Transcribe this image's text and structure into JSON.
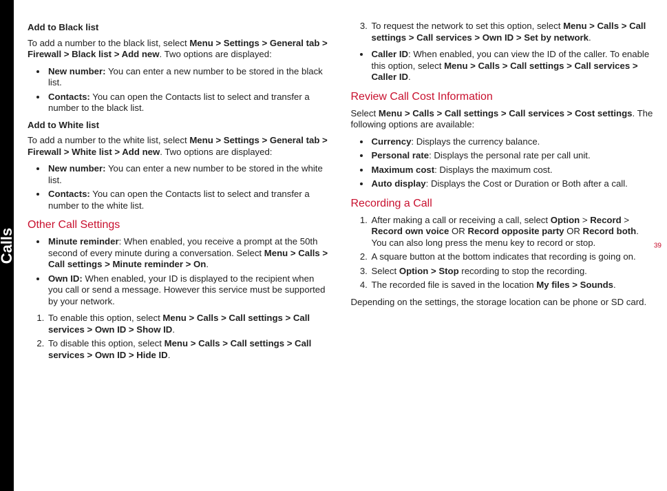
{
  "side_tab": "Calls",
  "page_number": "39",
  "left": {
    "h_black_list": "Add to Black list",
    "p_black_intro_a": "To add a number to the black list, select ",
    "p_black_intro_b": "Menu > Settings > General tab > Firewall > Black list > Add new",
    "p_black_intro_c": ". Two options are displayed:",
    "bl_newnum_b": "New number:",
    "bl_newnum_t": " You can enter a new number  to be stored in the black list.",
    "bl_contacts_b": "Contacts:",
    "bl_contacts_t": " You can open the Contacts list to select and transfer a number to the black list.",
    "h_white_list": "Add to White list",
    "p_white_intro_a": "To add a number to the white list, select ",
    "p_white_intro_b": "Menu > Settings > General tab > Firewall > White list > Add new",
    "p_white_intro_c": ". Two options are displayed:",
    "wl_newnum_b": "New number:",
    "wl_newnum_t": " You can enter a new number  to be stored in the white list.",
    "wl_contacts_b": "Contacts:",
    "wl_contacts_t": " You can open the Contacts list to select and transfer a number to the white list.",
    "h_other": "Other Call Settings",
    "other_min_b": "Minute reminder",
    "other_min_t1": ": When enabled, you receive a prompt at the 50th second of every minute during a conversation. Select ",
    "other_min_t2": "Menu > Calls > Call settings > Minute reminder > On",
    "other_min_t3": ".",
    "other_own_b": "Own ID:",
    "other_own_t": " When enabled,  your ID is displayed to the recipient when you call or send a message. However this service must be supported by your network.",
    "ol1_a": "To enable this option, select ",
    "ol1_b": "Menu > Calls > Call settings > Call services > Own ID > Show ID",
    "ol1_c": ".",
    "ol2_a": "To disable this option, select ",
    "ol2_b": "Menu > Calls > Call settings > Call services > Own ID > Hide ID",
    "ol2_c": "."
  },
  "right": {
    "ol3_a": "To request the network to set this option, select ",
    "ol3_b": "Menu > Calls > Call settings > Call services > Own ID > Set by network",
    "ol3_c": ".",
    "caller_b": "Caller ID",
    "caller_t1": ": When enabled, you can view the ID of the caller. To enable this option, select ",
    "caller_t2": "Menu > Calls > Call settings > Call services > Caller ID",
    "caller_t3": ".",
    "h_cost": "Review Call Cost Information",
    "cost_intro_a": "Select ",
    "cost_intro_b": "Menu > Calls > Call settings > Call services > Cost settings",
    "cost_intro_c": ". The following options are available:",
    "cost_cur_b": "Currency",
    "cost_cur_t": ": Displays the currency balance.",
    "cost_rate_b": "Personal rate",
    "cost_rate_t": ": Displays the personal rate per call unit.",
    "cost_max_b": "Maximum cost",
    "cost_max_t": ": Displays the maximum cost.",
    "cost_auto_b": "Auto display",
    "cost_auto_t": ": Displays the Cost or Duration or Both after a call.",
    "h_rec": "Recording a Call",
    "rec1_a": "After making a call or receiving a call, select ",
    "rec1_b": "Option",
    "rec1_c": " > ",
    "rec1_d": "Record",
    "rec1_e": " > ",
    "rec1_f": "Record own voice",
    "rec1_g": " OR ",
    "rec1_h": "Record opposite party",
    "rec1_i": " OR ",
    "rec1_j": "Record both",
    "rec1_k": ". You can also long press the menu key to record or stop.",
    "rec2": "A square button at the bottom indicates that recording is going on.",
    "rec3_a": "Select ",
    "rec3_b": "Option > Stop",
    "rec3_c": " recording to stop the recording.",
    "rec4_a": "The recorded file is saved in the location ",
    "rec4_b": "My files > Sounds",
    "rec4_c": ".",
    "rec_footer": "Depending on the settings, the storage location can be phone or SD card."
  }
}
